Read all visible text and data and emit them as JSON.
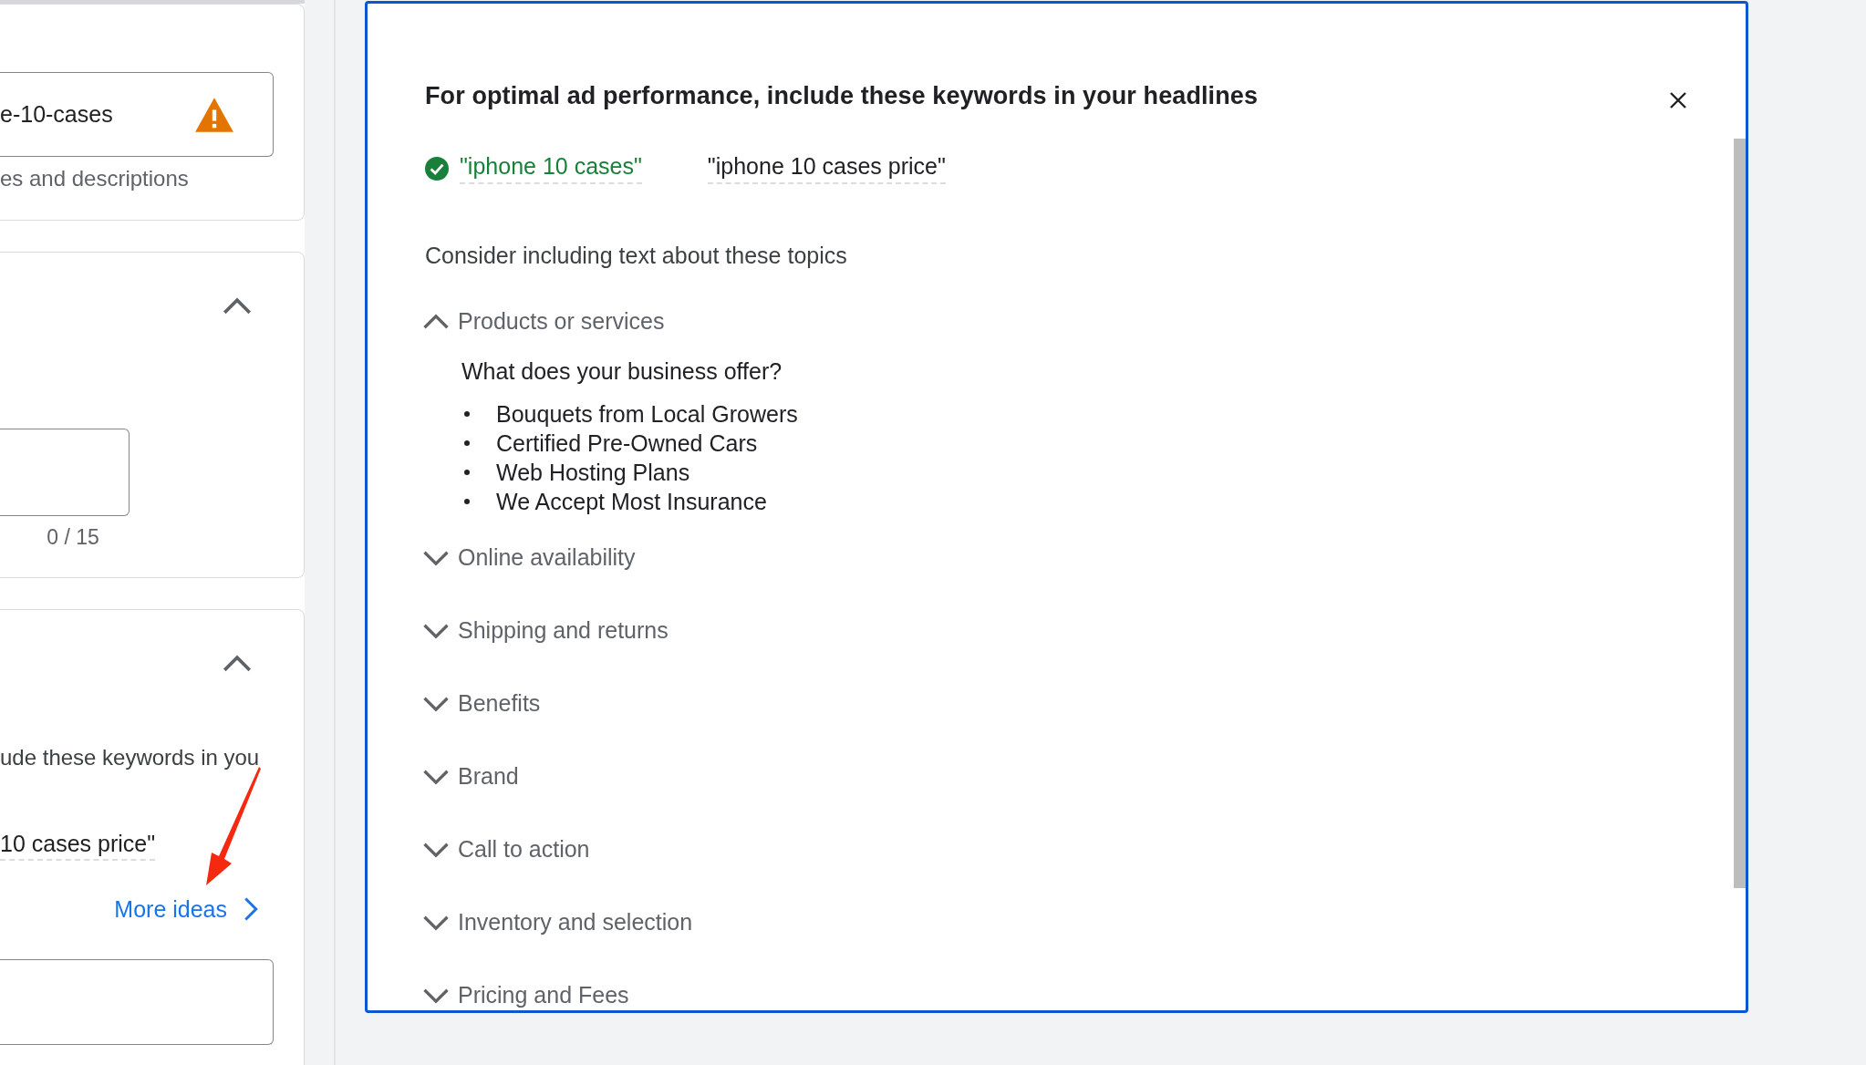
{
  "form": {
    "url_card": {
      "value": "e-10-cases",
      "helper": "es and descriptions"
    },
    "pins_card": {
      "expanded": true,
      "counter": "0 / 15"
    },
    "headline_card": {
      "expanded": true,
      "text": "ude these keywords in you",
      "keyword": "10 cases price\"",
      "link": "More ideas"
    }
  },
  "dialog": {
    "title": "For optimal ad performance, include these keywords in your headlines",
    "keywords": [
      {
        "text": "\"iphone 10 cases\"",
        "included": true
      },
      {
        "text": "\"iphone 10 cases price\"",
        "included": false
      }
    ],
    "topics_heading": "Consider including text about these topics",
    "topics": [
      {
        "label": "Products or services",
        "expanded": true,
        "question": "What does your business offer?",
        "examples": [
          "Bouquets from Local Growers",
          "Certified Pre-Owned Cars",
          "Web Hosting Plans",
          "We Accept Most Insurance"
        ]
      },
      {
        "label": "Online availability",
        "expanded": false
      },
      {
        "label": "Shipping and returns",
        "expanded": false
      },
      {
        "label": "Benefits",
        "expanded": false
      },
      {
        "label": "Brand",
        "expanded": false
      },
      {
        "label": "Call to action",
        "expanded": false
      },
      {
        "label": "Inventory and selection",
        "expanded": false
      },
      {
        "label": "Pricing and Fees",
        "expanded": false
      }
    ]
  }
}
